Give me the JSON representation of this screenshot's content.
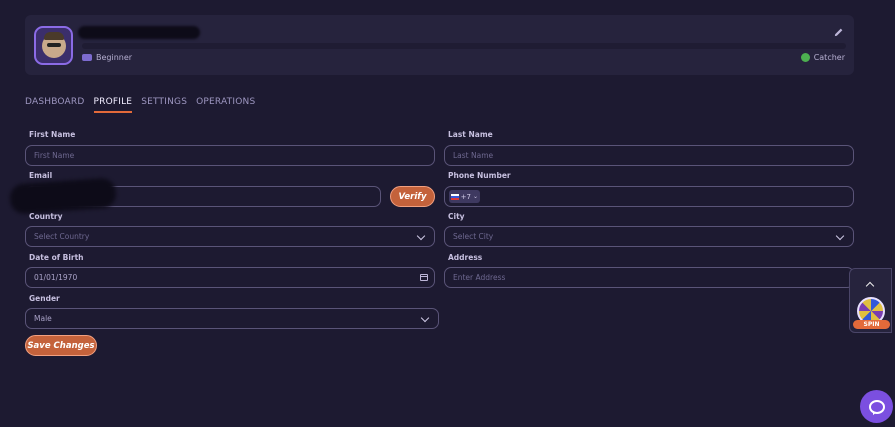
{
  "profile": {
    "rank": "Beginner",
    "next_rank": "Catcher"
  },
  "tabs": [
    {
      "label": "DASHBOARD"
    },
    {
      "label": "PROFILE"
    },
    {
      "label": "SETTINGS"
    },
    {
      "label": "OPERATIONS"
    }
  ],
  "form": {
    "first_name_label": "First Name",
    "first_name_placeholder": "First Name",
    "last_name_label": "Last Name",
    "last_name_placeholder": "Last Name",
    "email_label": "Email",
    "verify_label": "Verify",
    "phone_label": "Phone Number",
    "phone_code": "+7",
    "country_label": "Country",
    "country_placeholder": "Select Country",
    "city_label": "City",
    "city_placeholder": "Select City",
    "dob_label": "Date of Birth",
    "dob_value": "01/01/1970",
    "address_label": "Address",
    "address_placeholder": "Enter Address",
    "gender_label": "Gender",
    "gender_value": "Male",
    "save_label": "Save Changes"
  },
  "widget": {
    "spin_label": "SPIN"
  },
  "colors": {
    "accent": "#e36a3a",
    "background": "#1d1a31",
    "card": "#26233d",
    "chat": "#7b4fe0"
  }
}
